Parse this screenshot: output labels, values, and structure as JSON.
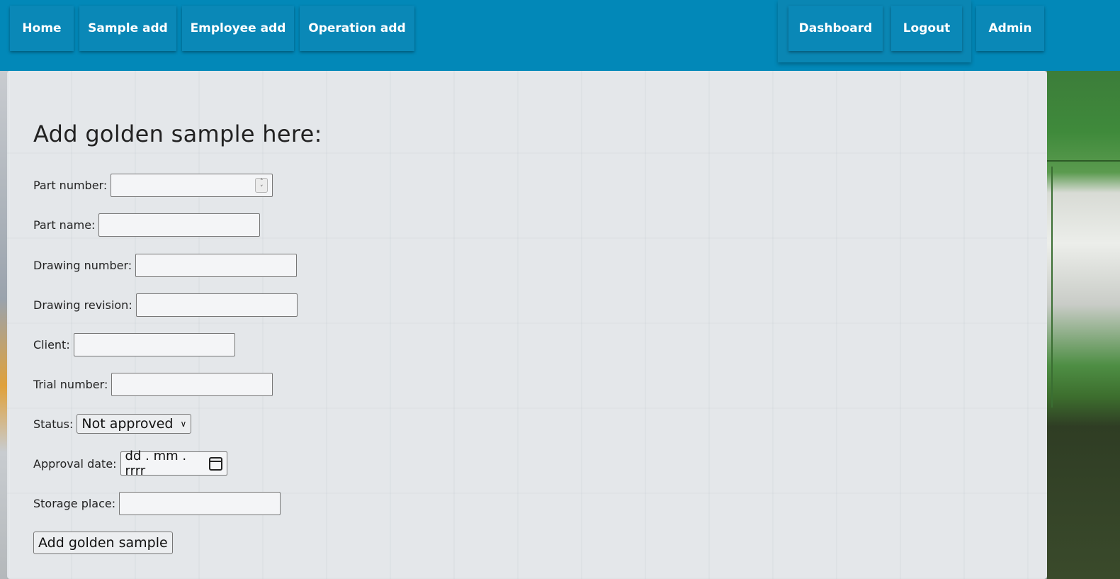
{
  "nav": {
    "home": "Home",
    "sample_add": "Sample add",
    "employee_add": "Employee add",
    "operation_add": "Operation add",
    "dashboard": "Dashboard",
    "logout": "Logout",
    "admin": "Admin"
  },
  "form": {
    "title": "Add golden sample here:",
    "part_number_label": "Part number:",
    "part_name_label": "Part name:",
    "drawing_number_label": "Drawing number:",
    "drawing_revision_label": "Drawing revision:",
    "client_label": "Client:",
    "trial_number_label": "Trial number:",
    "status_label": "Status:",
    "status_value": "Not approved",
    "approval_date_label": "Approval date:",
    "approval_date_placeholder": "dd . mm . rrrr",
    "storage_place_label": "Storage place:",
    "submit_label": "Add golden sample"
  },
  "colors": {
    "header": "#0288b8",
    "panel": "#e8ebee"
  }
}
